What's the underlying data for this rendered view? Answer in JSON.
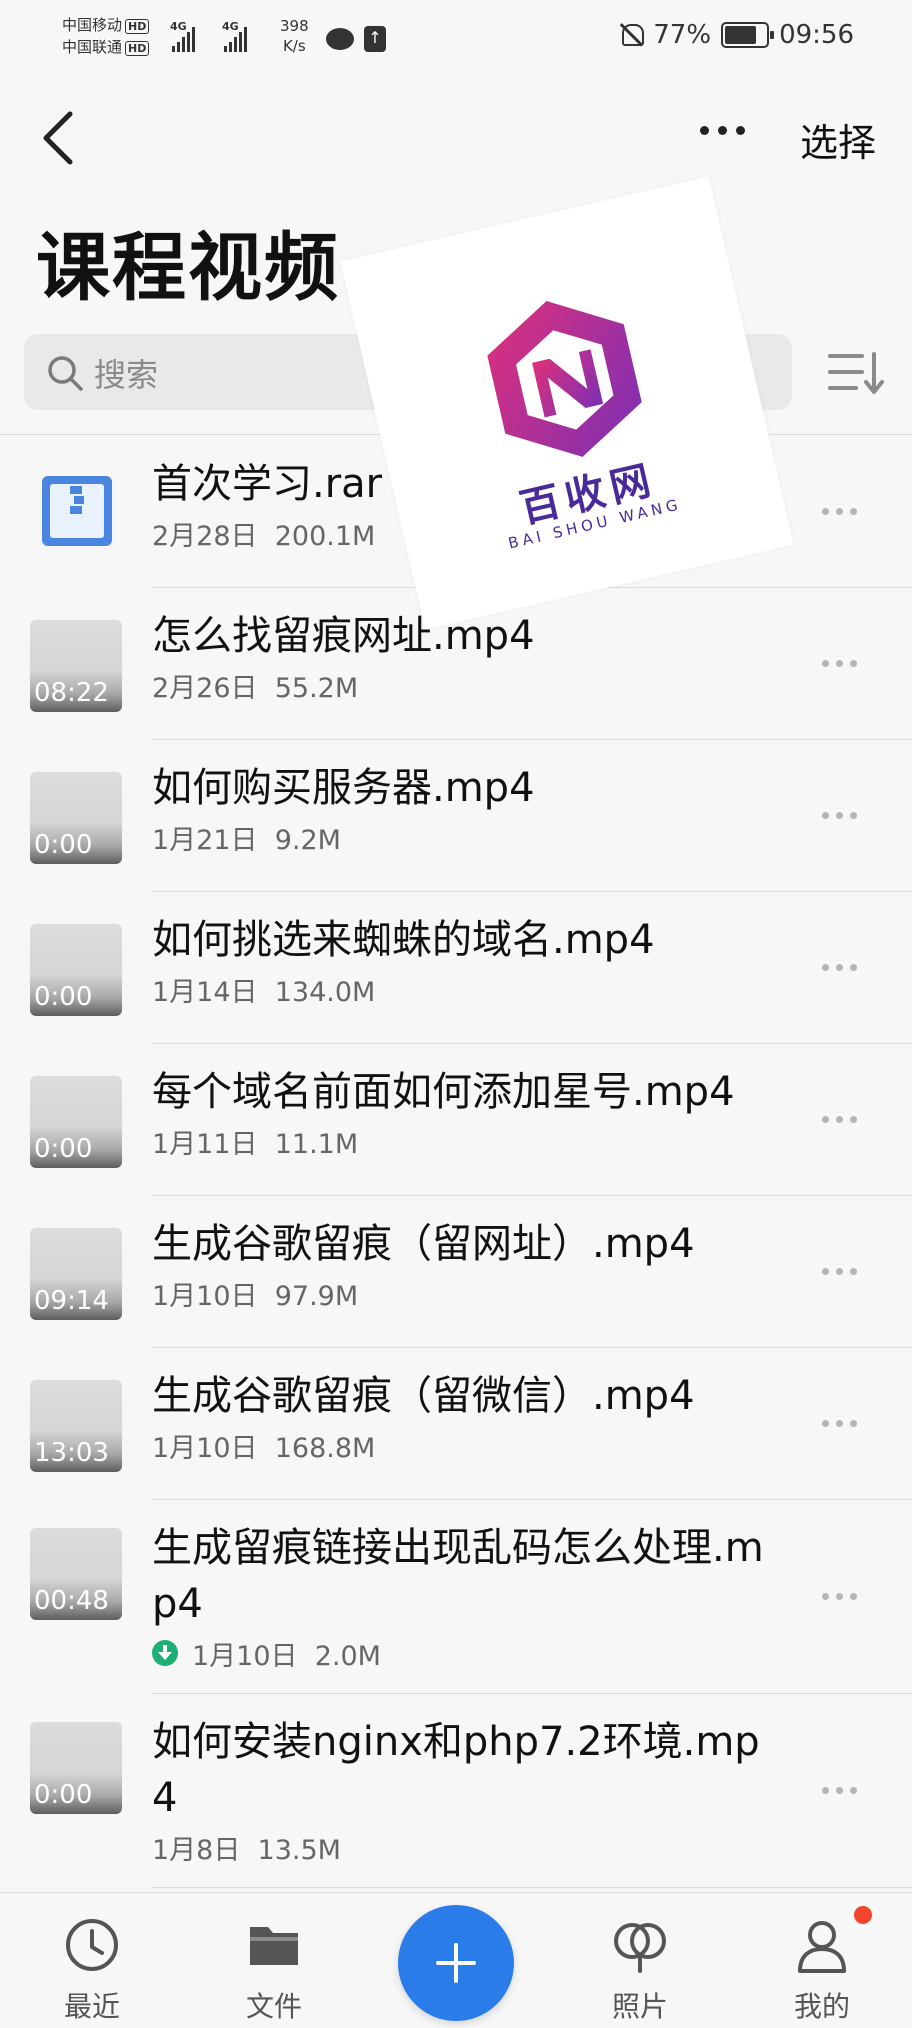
{
  "status_bar": {
    "carrier1": "中国移动",
    "carrier2": "中国联通",
    "hd": "HD",
    "net1": "4G",
    "net2": "4G",
    "speed_value": "398",
    "speed_unit": "K/s",
    "battery": "77%",
    "time": "09:56"
  },
  "header": {
    "title": "课程视频",
    "select_label": "选择",
    "back_icon": "back-arrow-icon",
    "more_icon": "more-horizontal-icon"
  },
  "search": {
    "placeholder": "搜索"
  },
  "watermark": {
    "name": "百收网",
    "sub": "BAI SHOU WANG"
  },
  "files": [
    {
      "name": "首次学习.rar",
      "date": "2月28日",
      "size": "200.1M",
      "type": "rar",
      "duration": ""
    },
    {
      "name": "怎么找留痕网址.mp4",
      "date": "2月26日",
      "size": "55.2M",
      "type": "video",
      "duration": "08:22"
    },
    {
      "name": "如何购买服务器.mp4",
      "date": "1月21日",
      "size": "9.2M",
      "type": "video",
      "duration": "0:00"
    },
    {
      "name": "如何挑选来蜘蛛的域名.mp4",
      "date": "1月14日",
      "size": "134.0M",
      "type": "video",
      "duration": "0:00"
    },
    {
      "name": "每个域名前面如何添加星号.mp4",
      "date": "1月11日",
      "size": "11.1M",
      "type": "video",
      "duration": "0:00"
    },
    {
      "name": "生成谷歌留痕（留网址）.mp4",
      "date": "1月10日",
      "size": "97.9M",
      "type": "video",
      "duration": "09:14"
    },
    {
      "name": "生成谷歌留痕（留微信）.mp4",
      "date": "1月10日",
      "size": "168.8M",
      "type": "video",
      "duration": "13:03"
    },
    {
      "name": "生成留痕链接出现乱码怎么处理.mp4",
      "date": "1月10日",
      "size": "2.0M",
      "type": "video",
      "duration": "00:48",
      "downloaded": true
    },
    {
      "name": "如何安装nginx和php7.2环境.mp4",
      "date": "1月8日",
      "size": "13.5M",
      "type": "video",
      "duration": "0:00"
    }
  ],
  "bottom_nav": [
    {
      "label": "最近",
      "icon": "clock-icon"
    },
    {
      "label": "文件",
      "icon": "folder-icon"
    },
    {
      "label": "",
      "icon": "add-icon"
    },
    {
      "label": "照片",
      "icon": "photos-icon"
    },
    {
      "label": "我的",
      "icon": "person-icon"
    }
  ],
  "colors": {
    "accent": "#2a7de9",
    "download_green": "#1fae74",
    "notification_red": "#f3452b",
    "background": "#f7f7f7"
  }
}
